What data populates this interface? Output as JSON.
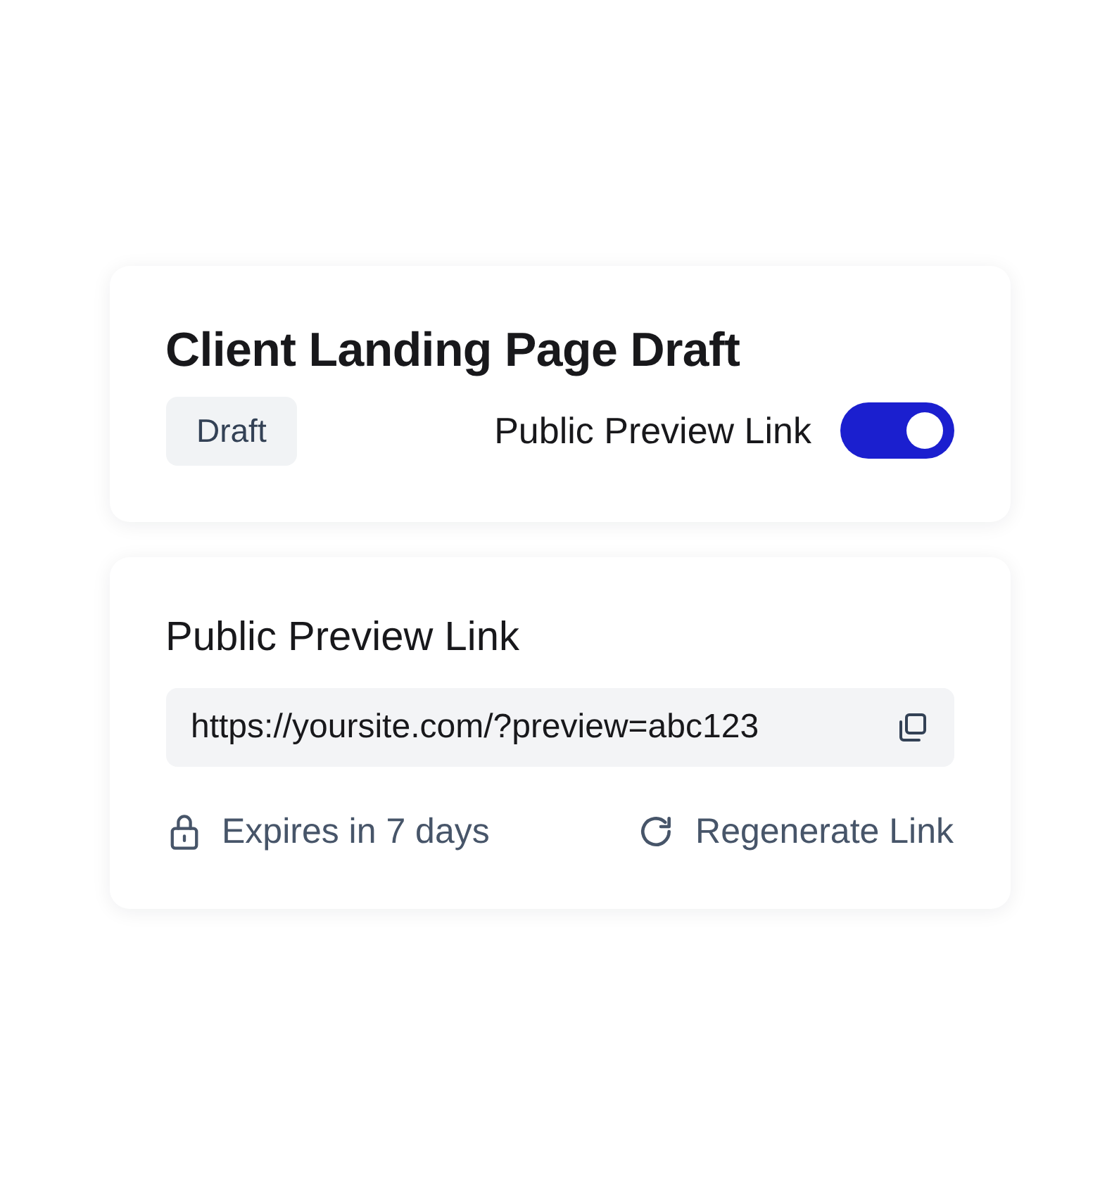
{
  "header_card": {
    "title": "Client Landing Page Draft",
    "status_badge": "Draft",
    "preview_toggle": {
      "label": "Public Preview Link",
      "on": true
    }
  },
  "link_card": {
    "heading": "Public Preview Link",
    "url": "https://yoursite.com/?preview=abc123",
    "expiry": "Expires in 7 days",
    "regenerate": "Regenerate Link"
  }
}
